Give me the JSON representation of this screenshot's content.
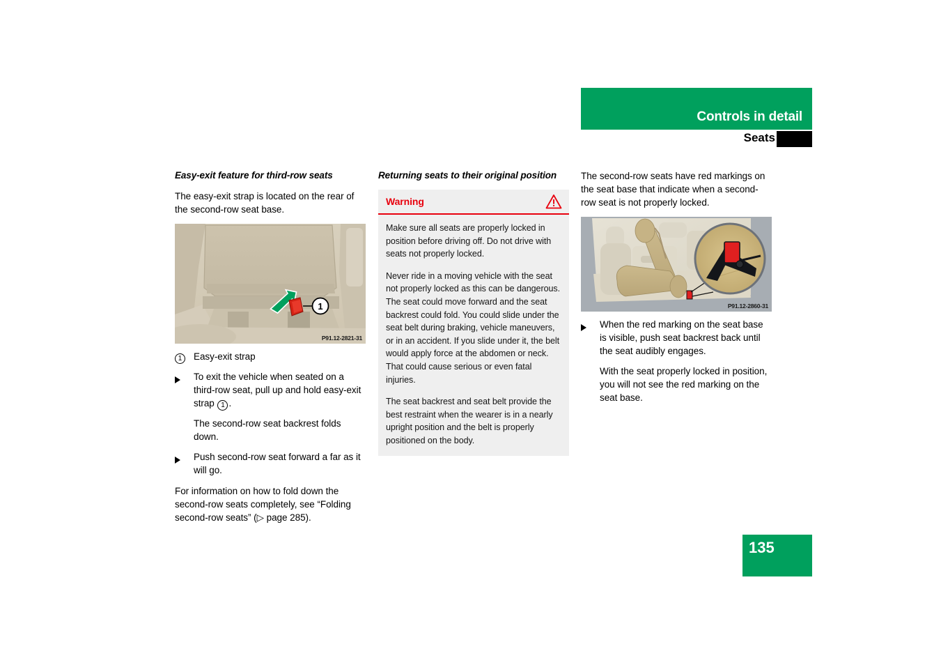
{
  "header": {
    "title": "Controls in detail",
    "subtitle": "Seats",
    "accent_green": "#00a05d",
    "tab_black": "#000000"
  },
  "page_number": "135",
  "left_column": {
    "section_title": "Easy-exit feature for third-row seats",
    "intro": "The easy-exit strap is located on the rear of the second-row seat base.",
    "figure": {
      "caption": "P91.12-2821-31",
      "alt": "rear view of second-row seat base with red easy-exit strap and green pull arrow, callout 1"
    },
    "legend": {
      "number": "1",
      "label": "Easy-exit strap"
    },
    "steps": [
      {
        "marker": "triangle-bullet",
        "text_before": "To exit the vehicle when seated on a third-row seat, pull up and hold easy-exit strap",
        "inline_number": "1",
        "text_after": "."
      },
      {
        "marker": "none",
        "text_before": "The second-row seat backrest folds down.",
        "inline_number": "",
        "text_after": ""
      },
      {
        "marker": "triangle-bullet",
        "text_before": "Push second-row seat forward a far as it will go.",
        "inline_number": "",
        "text_after": ""
      }
    ],
    "closing": "For information on how to fold down the second-row seats completely, see “Folding second-row seats” (▷ page 285)."
  },
  "middle_column": {
    "section_title": "Returning seats to their original position",
    "warning": {
      "title": "Warning",
      "icon": "warning-triangle-icon",
      "accent_red": "#e8000d",
      "background": "#efefef",
      "paragraphs": [
        "Make sure all seats are properly locked in position before driving off. Do not drive with seats not properly locked.",
        "Never ride in a moving vehicle with the seat not properly locked as this can be dangerous. The seat could move forward and the seat backrest could fold. You could slide under the seat belt during braking, vehicle maneuvers, or in an accident. If you slide under it, the belt would apply force at the abdomen or neck. That could cause serious or even fatal injuries.",
        "The seat backrest and seat belt provide the best restraint when the wearer is in a nearly upright position and the belt is properly positioned on the body."
      ]
    }
  },
  "right_column": {
    "intro": "The second-row seats have red markings on the seat base that indicate when a second-row seat is not properly locked.",
    "figure": {
      "caption": "P91.12-2860-31",
      "alt": "vehicle interior showing folded second-row seat with magnified inset of red lock marking"
    },
    "steps": [
      {
        "marker": "triangle-bullet",
        "text": "When the red marking on the seat base is visible, push seat backrest back until the seat audibly engages."
      },
      {
        "marker": "none",
        "text": "With the seat properly locked in position, you will not see the red marking on the seat base."
      }
    ]
  }
}
